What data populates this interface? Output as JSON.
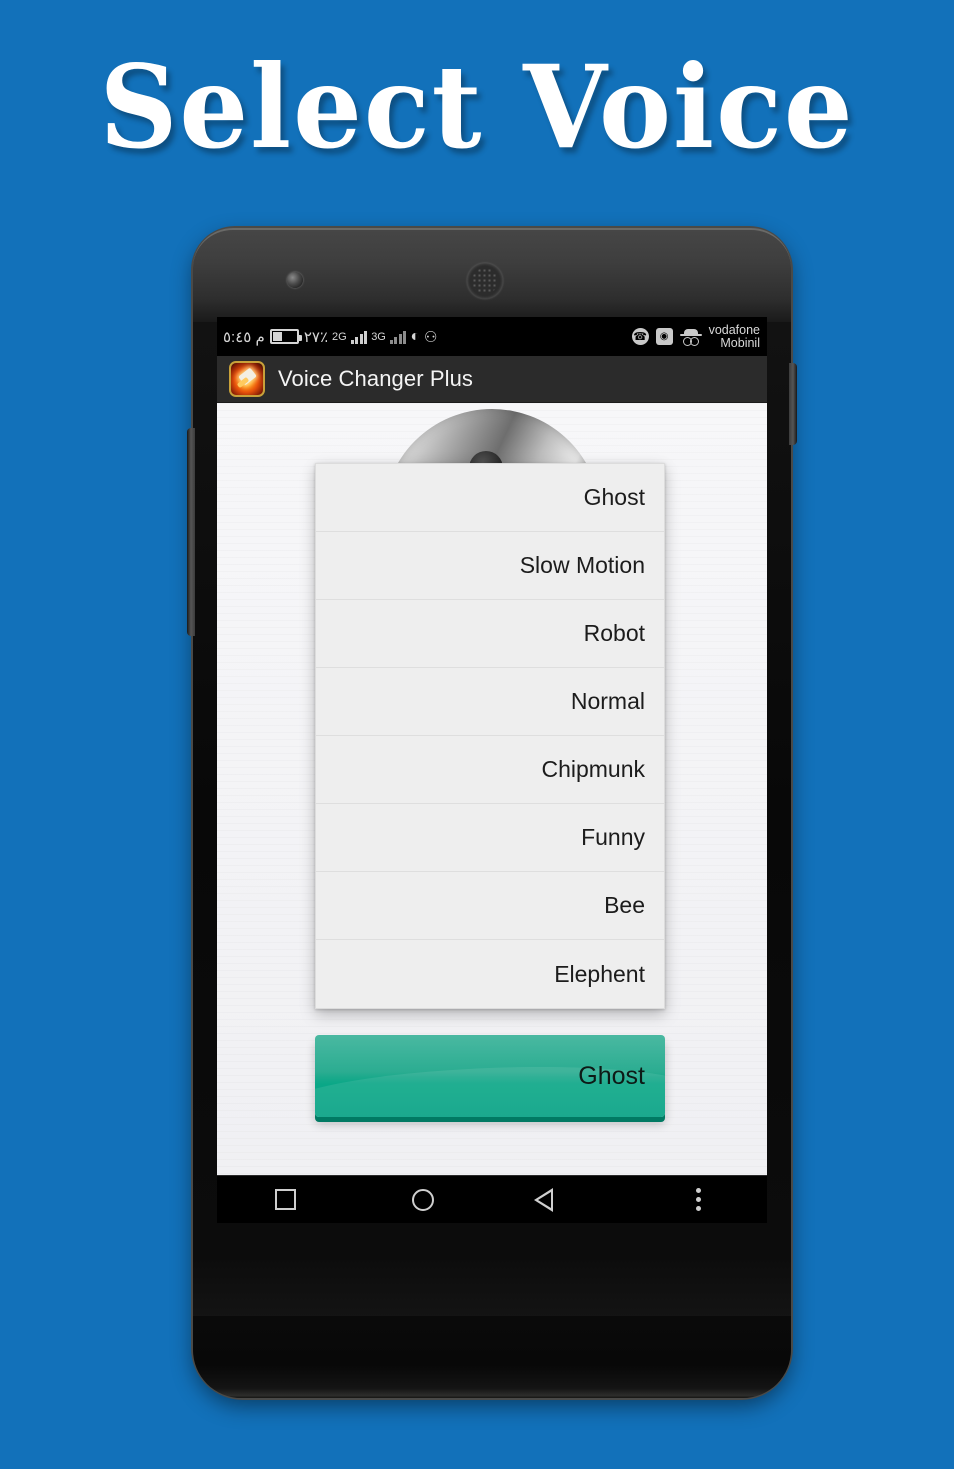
{
  "banner": {
    "title": "Select Voice",
    "background_color": "#1271ba",
    "title_color": "#ffffff"
  },
  "phone": {
    "front_camera": "front-camera-icon",
    "earpiece": "earpiece-speaker-icon",
    "volume_button": "volume-rocker",
    "power_button": "power-button"
  },
  "status_bar": {
    "time": "م ٥:٤٥",
    "battery_percent": "٢٧٪",
    "network_2g_label": "2G",
    "network_3g_label": "3G",
    "wifi_icon": "wifi-icon",
    "vibrate_icon": "vibrate-icon",
    "call_icon": "phone-call-icon",
    "camera_icon": "camera-icon",
    "incognito_icon": "incognito-icon",
    "carrier_line1": "vodafone",
    "carrier_line2": "Mobinil"
  },
  "action_bar": {
    "app_icon": "voice-changer-app-icon",
    "title": "Voice Changer Plus",
    "background_color": "#2b2b2b"
  },
  "main": {
    "microphone_image": "microphone-head-image",
    "dropdown": {
      "name": "voice-effect-dropdown",
      "items": [
        {
          "label": "Ghost"
        },
        {
          "label": "Slow Motion"
        },
        {
          "label": "Robot"
        },
        {
          "label": "Normal"
        },
        {
          "label": "Chipmunk"
        },
        {
          "label": "Funny"
        },
        {
          "label": "Bee"
        },
        {
          "label": "Elephent"
        }
      ]
    },
    "select_button": {
      "label": "Ghost",
      "color": "#0aa787",
      "shadow_color": "#017a63"
    }
  },
  "nav_bar": {
    "recent_icon": "recent-apps-icon",
    "home_icon": "home-icon",
    "back_icon": "back-icon",
    "menu_icon": "overflow-menu-icon"
  }
}
